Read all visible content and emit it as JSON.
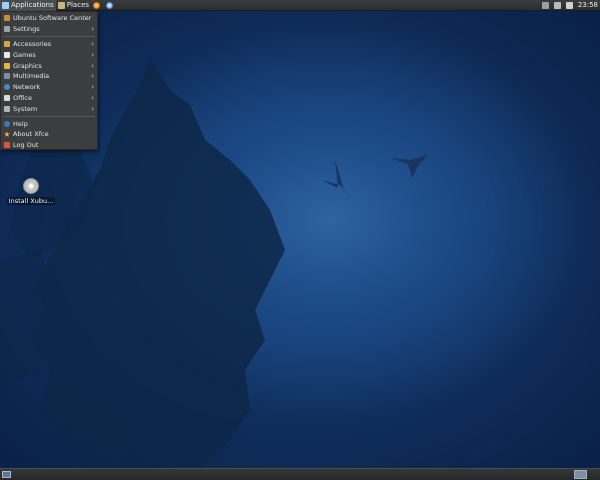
{
  "top_panel": {
    "applications_label": "Applications",
    "places_label": "Places",
    "clock": "23:58"
  },
  "app_menu": {
    "items": [
      {
        "label": "Ubuntu Software Center",
        "icon": "software-center-icon",
        "submenu": false
      },
      {
        "label": "Settings",
        "icon": "settings-icon",
        "submenu": true
      },
      {
        "label": "Accessories",
        "icon": "accessories-icon",
        "submenu": true
      },
      {
        "label": "Games",
        "icon": "games-icon",
        "submenu": true
      },
      {
        "label": "Graphics",
        "icon": "graphics-icon",
        "submenu": true
      },
      {
        "label": "Multimedia",
        "icon": "multimedia-icon",
        "submenu": true
      },
      {
        "label": "Network",
        "icon": "network-icon",
        "submenu": true
      },
      {
        "label": "Office",
        "icon": "office-icon",
        "submenu": true
      },
      {
        "label": "System",
        "icon": "system-icon",
        "submenu": true
      },
      {
        "label": "Help",
        "icon": "help-icon",
        "submenu": false
      },
      {
        "label": "About Xfce",
        "icon": "about-star-icon",
        "submenu": false
      },
      {
        "label": "Log Out",
        "icon": "logout-icon",
        "submenu": false
      }
    ]
  },
  "desktop": {
    "install_icon_label": "Install Xubu..."
  },
  "colors": {
    "panel": "#2e3032",
    "menu_bg": "#3c3d3e",
    "desktop_blue": "#1c4a86"
  }
}
